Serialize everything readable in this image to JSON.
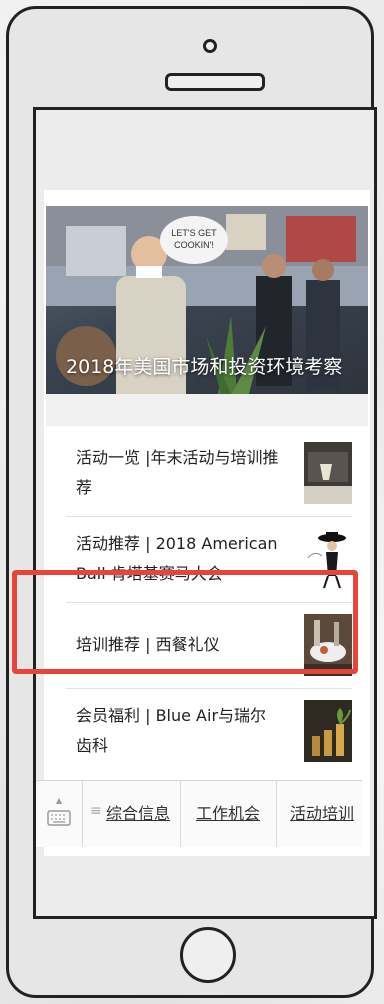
{
  "feed": {
    "hero": {
      "caption": "2018年美国市场和投资环境考察",
      "sign_text": "LET'S GET COOKIN'!"
    },
    "articles": [
      {
        "title": "活动一览 |年末活动与培训推荐"
      },
      {
        "title": "活动推荐 | 2018 American Ball 肯塔基赛马大会"
      },
      {
        "title": "培训推荐 | 西餐礼仪"
      },
      {
        "title": "会员福利 | Blue Air与瑞尔齿科"
      }
    ],
    "highlight_color": "#e6463a"
  },
  "tabbar": {
    "menu_glyph": "≡",
    "tabs": [
      {
        "label": "综合信息"
      },
      {
        "label": "工作机会"
      },
      {
        "label": "活动培训"
      }
    ]
  }
}
